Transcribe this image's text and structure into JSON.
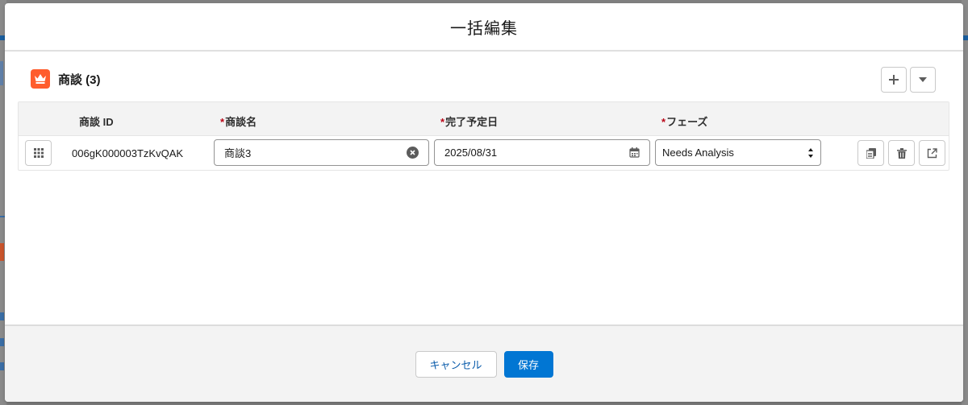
{
  "modal": {
    "title": "一括編集"
  },
  "card": {
    "title": "商談 (3)",
    "icon": "crown-icon",
    "accent": "#ff5d2d"
  },
  "header_buttons": {
    "add_icon": "plus-icon",
    "menu_icon": "caret-down-icon"
  },
  "table": {
    "columns": [
      {
        "label": "商談 ID",
        "required": false
      },
      {
        "label": "商談名",
        "required": true
      },
      {
        "label": "完了予定日",
        "required": true
      },
      {
        "label": "フェーズ",
        "required": true
      }
    ],
    "required_mark": "*",
    "rows": [
      {
        "id": "006gK000003TzKvQAK",
        "name": "商談3",
        "close_date": "2025/08/31",
        "stage": "Needs Analysis"
      }
    ]
  },
  "footer": {
    "cancel_label": "キャンセル",
    "save_label": "保存",
    "brand_color": "#0176d3"
  }
}
